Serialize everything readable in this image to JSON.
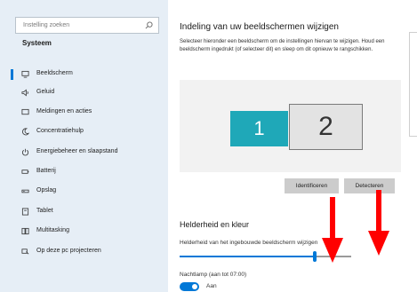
{
  "sidebar": {
    "search_placeholder": "Instelling zoeken",
    "section_title": "Systeem",
    "items": [
      {
        "label": "Beeldscherm",
        "icon": "monitor-icon",
        "active": true
      },
      {
        "label": "Geluid",
        "icon": "speaker-icon"
      },
      {
        "label": "Meldingen en acties",
        "icon": "notification-icon"
      },
      {
        "label": "Concentratiehulp",
        "icon": "moon-icon"
      },
      {
        "label": "Energiebeheer en slaapstand",
        "icon": "power-icon"
      },
      {
        "label": "Batterij",
        "icon": "battery-icon"
      },
      {
        "label": "Opslag",
        "icon": "storage-icon"
      },
      {
        "label": "Tablet",
        "icon": "tablet-icon"
      },
      {
        "label": "Multitasking",
        "icon": "multitasking-icon"
      },
      {
        "label": "Op deze pc projecteren",
        "icon": "project-icon"
      }
    ]
  },
  "main": {
    "title": "Indeling van uw beeldschermen wijzigen",
    "description": "Selecteer hieronder een beeldscherm om de instellingen hiervan te wijzigen. Houd een beeldscherm ingedrukt (of selecteer dit) en sleep om dit opnieuw te rangschikken.",
    "monitors": [
      "1",
      "2"
    ],
    "identify_button": "Identificeren",
    "detect_button": "Detecteren",
    "brightness_heading": "Helderheid en kleur",
    "brightness_label": "Helderheid van het ingebouwde beeldscherm wijzigen",
    "brightness_level": 0.79,
    "nightlight_label": "Nachtlamp (aan tot 07:00)",
    "toggle_label": "Aan",
    "toggle_on": true
  },
  "colors": {
    "accent": "#0078d7",
    "selected_monitor": "#1fa8b8",
    "annotation_arrow": "#ff0000"
  }
}
